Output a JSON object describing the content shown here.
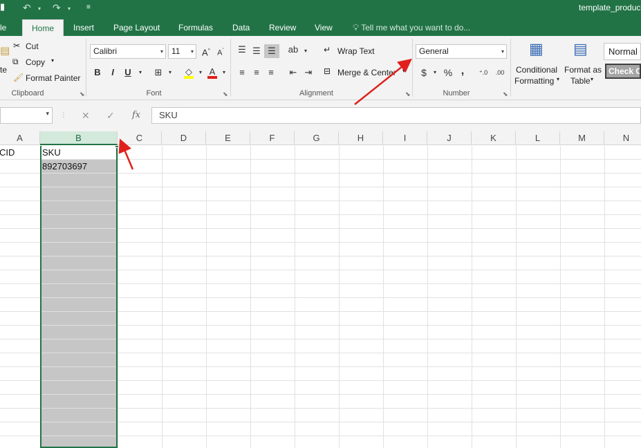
{
  "titlebar": {
    "doc_title": "template_produc"
  },
  "tabs": [
    {
      "label": "le",
      "active": false
    },
    {
      "label": "Home",
      "active": true
    },
    {
      "label": "Insert",
      "active": false
    },
    {
      "label": "Page Layout",
      "active": false
    },
    {
      "label": "Formulas",
      "active": false
    },
    {
      "label": "Data",
      "active": false
    },
    {
      "label": "Review",
      "active": false
    },
    {
      "label": "View",
      "active": false
    }
  ],
  "tell_me": "Tell me what you want to do...",
  "clipboard": {
    "paste_label": "te",
    "cut": "Cut",
    "copy": "Copy",
    "format_painter": "Format Painter",
    "group_label": "Clipboard"
  },
  "font": {
    "name": "Calibri",
    "size": "11",
    "bold": "B",
    "italic": "I",
    "underline": "U",
    "group_label": "Font"
  },
  "alignment": {
    "wrap_text": "Wrap Text",
    "merge_center": "Merge & Center",
    "group_label": "Alignment"
  },
  "number": {
    "format": "General",
    "currency": "$",
    "percent": "%",
    "comma": ",",
    "group_label": "Number"
  },
  "styles": {
    "conditional_line1": "Conditional",
    "conditional_line2": "Formatting",
    "format_as_line1": "Format as",
    "format_as_line2": "Table",
    "normal": "Normal",
    "check_cell": "Check C"
  },
  "formula_bar": {
    "name_box": "",
    "fx": "fx",
    "value": "SKU"
  },
  "columns": [
    "A",
    "B",
    "C",
    "D",
    "E",
    "F",
    "G",
    "H",
    "I",
    "J",
    "K",
    "L",
    "M",
    "N"
  ],
  "selected_column": "B",
  "cells": {
    "A1": "CID",
    "B1": "SKU",
    "B2": "892703697"
  },
  "colors": {
    "excel_green": "#217346",
    "selection_gray": "#c6c6c6",
    "annotation_red": "#e0201c"
  }
}
